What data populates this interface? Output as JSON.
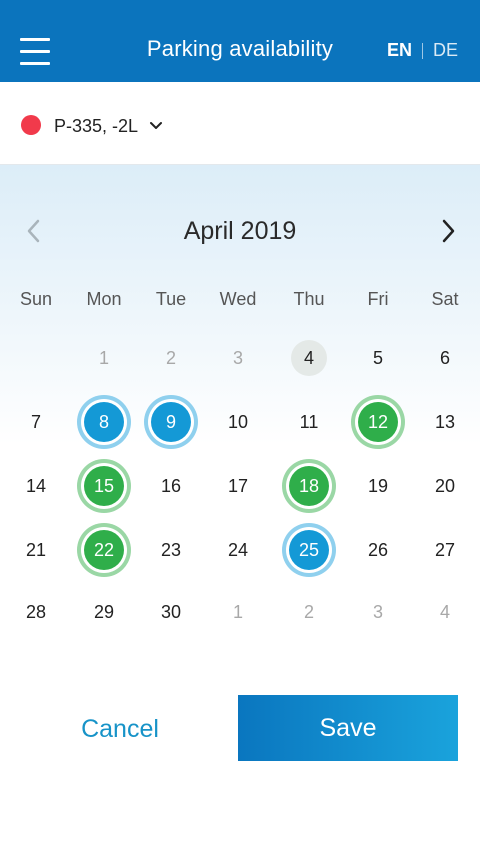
{
  "header": {
    "title": "Parking availability",
    "lang_en": "EN",
    "lang_de": "DE"
  },
  "lot": {
    "label": "P-335, -2L",
    "status_color": "#f13a4b"
  },
  "calendar": {
    "month_label": "April 2019",
    "weekdays": [
      "Sun",
      "Mon",
      "Tue",
      "Wed",
      "Thu",
      "Fri",
      "Sat"
    ],
    "weeks": [
      [
        {
          "d": "",
          "s": "empty"
        },
        {
          "d": "1",
          "s": "muted"
        },
        {
          "d": "2",
          "s": "muted"
        },
        {
          "d": "3",
          "s": "muted"
        },
        {
          "d": "4",
          "s": "today"
        },
        {
          "d": "5",
          "s": "normal"
        },
        {
          "d": "6",
          "s": "normal"
        }
      ],
      [
        {
          "d": "7",
          "s": "normal"
        },
        {
          "d": "8",
          "s": "blue"
        },
        {
          "d": "9",
          "s": "blue"
        },
        {
          "d": "10",
          "s": "normal"
        },
        {
          "d": "11",
          "s": "normal"
        },
        {
          "d": "12",
          "s": "green"
        },
        {
          "d": "13",
          "s": "normal"
        }
      ],
      [
        {
          "d": "14",
          "s": "normal"
        },
        {
          "d": "15",
          "s": "green"
        },
        {
          "d": "16",
          "s": "normal"
        },
        {
          "d": "17",
          "s": "normal"
        },
        {
          "d": "18",
          "s": "green"
        },
        {
          "d": "19",
          "s": "normal"
        },
        {
          "d": "20",
          "s": "normal"
        }
      ],
      [
        {
          "d": "21",
          "s": "normal"
        },
        {
          "d": "22",
          "s": "green"
        },
        {
          "d": "23",
          "s": "normal"
        },
        {
          "d": "24",
          "s": "normal"
        },
        {
          "d": "25",
          "s": "blue"
        },
        {
          "d": "26",
          "s": "normal"
        },
        {
          "d": "27",
          "s": "normal"
        }
      ],
      [
        {
          "d": "28",
          "s": "normal"
        },
        {
          "d": "29",
          "s": "normal"
        },
        {
          "d": "30",
          "s": "normal"
        },
        {
          "d": "1",
          "s": "muted"
        },
        {
          "d": "2",
          "s": "muted"
        },
        {
          "d": "3",
          "s": "muted"
        },
        {
          "d": "4",
          "s": "muted"
        }
      ]
    ],
    "colors": {
      "booked_blue": "#1499d6",
      "available_green": "#2fae4a"
    }
  },
  "actions": {
    "cancel_label": "Cancel",
    "save_label": "Save"
  },
  "icons": {
    "menu": "hamburger-icon",
    "prev": "chevron-left-icon",
    "next": "chevron-right-icon",
    "dropdown": "chevron-down-icon"
  }
}
